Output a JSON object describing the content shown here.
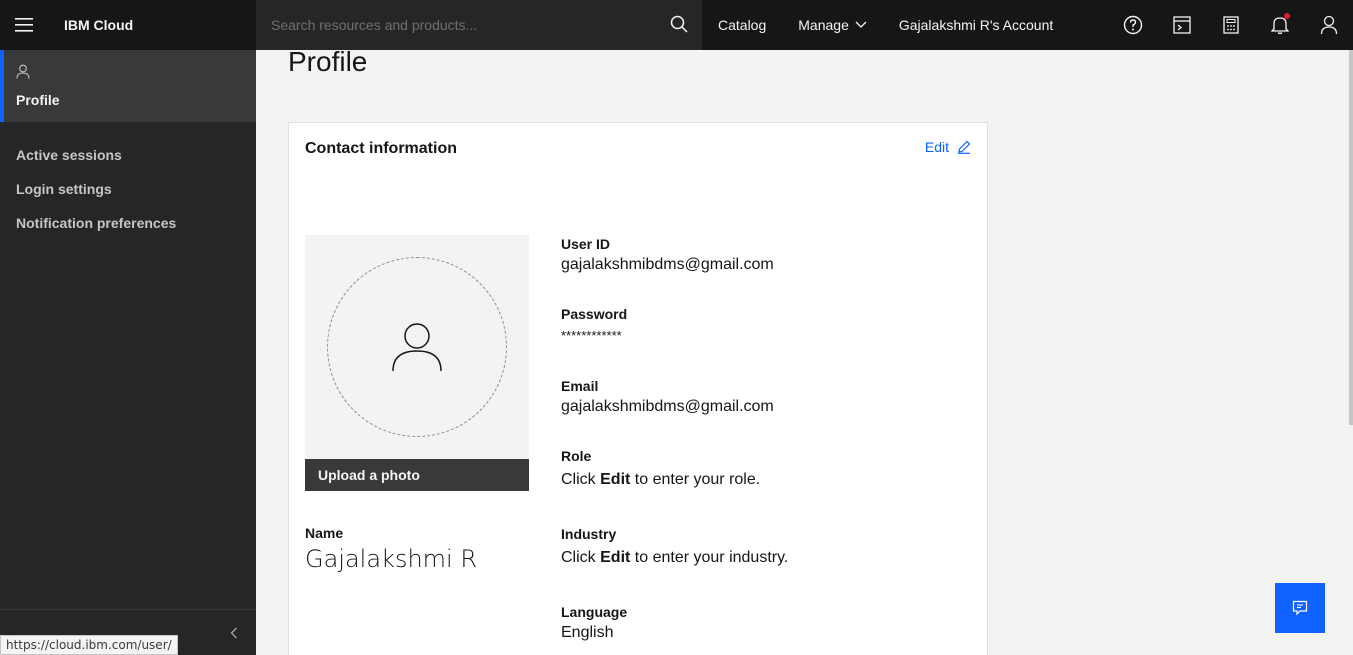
{
  "header": {
    "brand": "IBM Cloud",
    "search_placeholder": "Search resources and products...",
    "nav": {
      "catalog": "Catalog",
      "manage": "Manage",
      "account": "Gajalakshmi R's Account"
    },
    "icons": [
      "help-icon",
      "terminal-icon",
      "calculator-icon",
      "notification-icon",
      "user-icon"
    ]
  },
  "sidebar": {
    "active_item": "Profile",
    "items": [
      {
        "label": "Active sessions"
      },
      {
        "label": "Login settings"
      },
      {
        "label": "Notification preferences"
      }
    ]
  },
  "status_url": "https://cloud.ibm.com/user/",
  "page": {
    "title": "Profile"
  },
  "contact": {
    "title": "Contact information",
    "edit_label": "Edit",
    "upload_label": "Upload a photo",
    "name_label": "Name",
    "name_value": "Gajalakshmi R",
    "fields": [
      {
        "label": "User ID",
        "value": "gajalakshmibdms@gmail.com"
      },
      {
        "label": "Password",
        "value": "************"
      },
      {
        "label": "Email",
        "value": "gajalakshmibdms@gmail.com"
      },
      {
        "label": "Role",
        "prefix": "Click",
        "bold": "Edit",
        "suffix": "to enter your role."
      },
      {
        "label": "Industry",
        "prefix": "Click",
        "bold": "Edit",
        "suffix": "to enter your industry."
      },
      {
        "label": "Language",
        "value": "English"
      }
    ]
  },
  "colors": {
    "accent": "#0f62fe",
    "header_bg": "#161616",
    "sidebar_bg": "#262626",
    "notification_dot": "#da1e28"
  }
}
